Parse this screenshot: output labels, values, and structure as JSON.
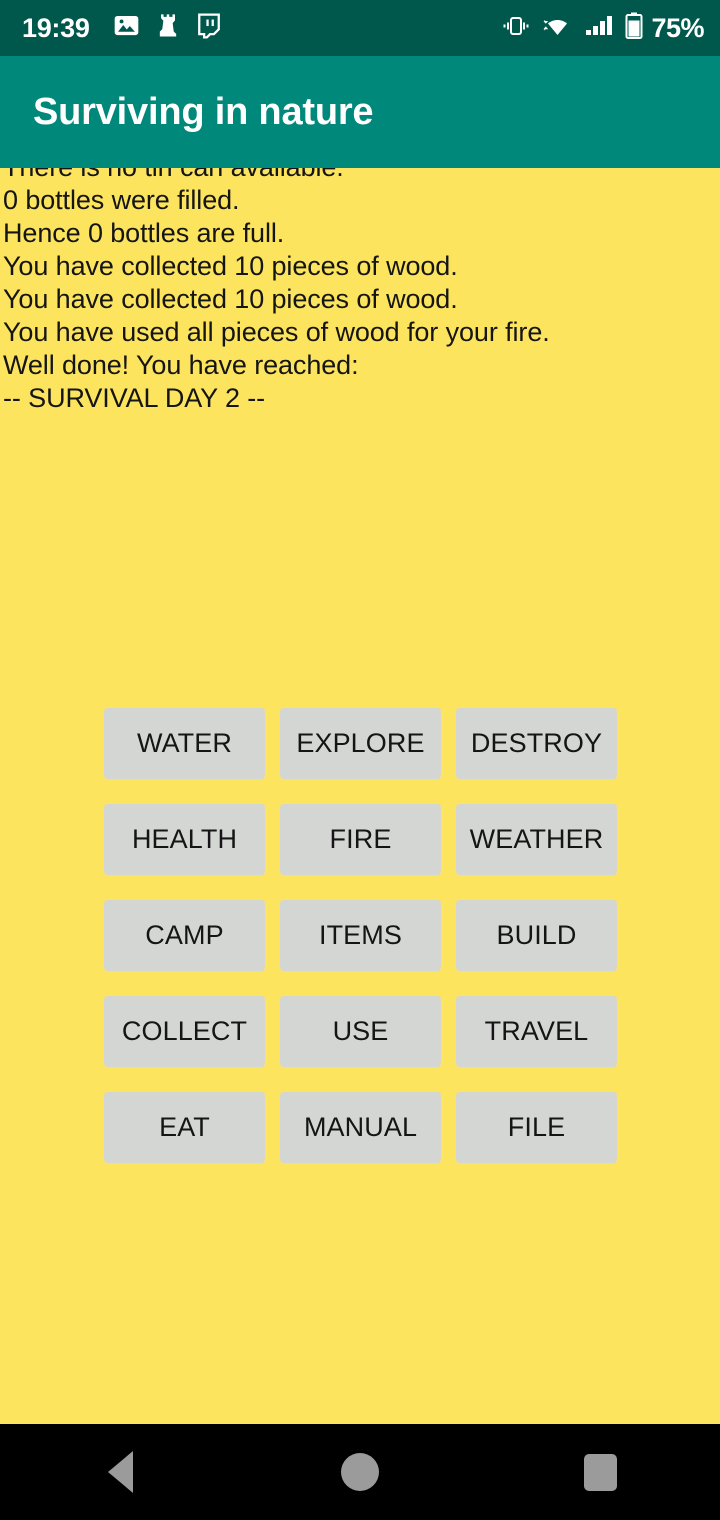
{
  "status_bar": {
    "clock": "19:39",
    "battery_percent": "75%",
    "background_color": "#00584C",
    "left_icons": [
      {
        "name": "photos-icon",
        "label": "Photos"
      },
      {
        "name": "chess-rook-icon",
        "label": "Chess"
      },
      {
        "name": "twitch-icon",
        "label": "Twitch"
      }
    ],
    "right_icons": [
      {
        "name": "vibrate-icon",
        "label": "Vibrate"
      },
      {
        "name": "wifi-icon",
        "label": "Wi-Fi"
      },
      {
        "name": "cellular-signal-icon",
        "label": "Signal"
      },
      {
        "name": "battery-icon",
        "label": "Battery"
      }
    ]
  },
  "app_bar": {
    "title": "Surviving in nature",
    "background_color": "#00897B",
    "text_color": "#FFFFFF"
  },
  "screen": {
    "background_color": "#FCE45E",
    "text_color": "#151515"
  },
  "log": {
    "lines": [
      "There is no tin can available.",
      "0 bottles were filled.",
      "Hence 0 bottles are full.",
      "You have collected 10 pieces of wood.",
      "You have collected 10 pieces of wood.",
      "You have used all pieces of wood for your fire.",
      "Well done! You have reached:",
      "-- SURVIVAL DAY 2 --"
    ]
  },
  "actions": {
    "button_color": "#D4D6D4",
    "buttons": [
      {
        "label": "WATER",
        "name": "water-button"
      },
      {
        "label": "EXPLORE",
        "name": "explore-button"
      },
      {
        "label": "DESTROY",
        "name": "destroy-button"
      },
      {
        "label": "HEALTH",
        "name": "health-button"
      },
      {
        "label": "FIRE",
        "name": "fire-button"
      },
      {
        "label": "WEATHER",
        "name": "weather-button"
      },
      {
        "label": "CAMP",
        "name": "camp-button"
      },
      {
        "label": "ITEMS",
        "name": "items-button"
      },
      {
        "label": "BUILD",
        "name": "build-button"
      },
      {
        "label": "COLLECT",
        "name": "collect-button"
      },
      {
        "label": "USE",
        "name": "use-button"
      },
      {
        "label": "TRAVEL",
        "name": "travel-button"
      },
      {
        "label": "EAT",
        "name": "eat-button"
      },
      {
        "label": "MANUAL",
        "name": "manual-button"
      },
      {
        "label": "FILE",
        "name": "file-button"
      }
    ]
  },
  "nav_bar": {
    "background_color": "#000000",
    "icon_color": "#9B9B9B",
    "items": [
      {
        "name": "nav-back-button",
        "label": "Back"
      },
      {
        "name": "nav-home-button",
        "label": "Home"
      },
      {
        "name": "nav-recents-button",
        "label": "Recents"
      }
    ]
  }
}
